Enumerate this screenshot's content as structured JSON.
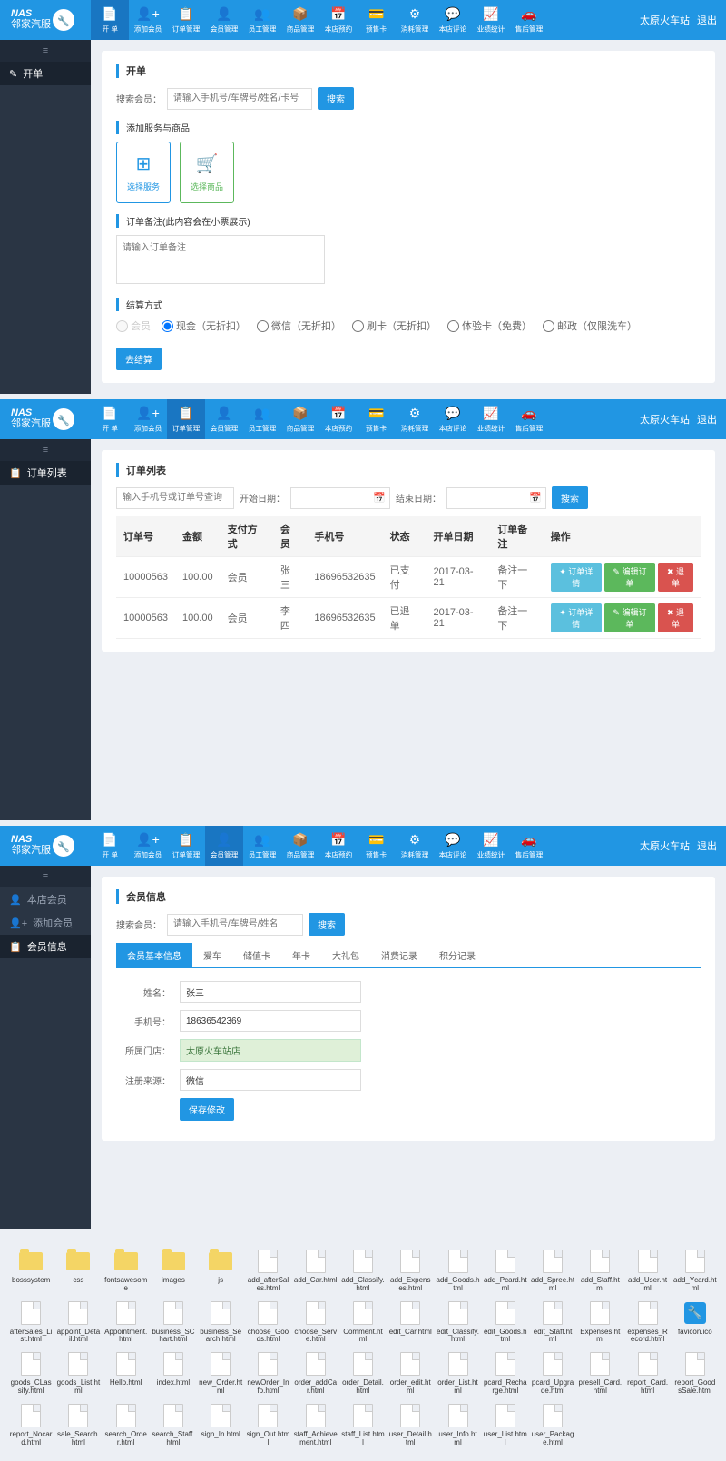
{
  "topbar": {
    "station": "太原火车站",
    "logout": "退出"
  },
  "nav": [
    {
      "label": "开 单",
      "icon": "📄"
    },
    {
      "label": "添加会员",
      "icon": "👤+"
    },
    {
      "label": "订单管理",
      "icon": "📋"
    },
    {
      "label": "会员管理",
      "icon": "👤"
    },
    {
      "label": "员工管理",
      "icon": "👥"
    },
    {
      "label": "商品管理",
      "icon": "📦"
    },
    {
      "label": "本店预约",
      "icon": "📅"
    },
    {
      "label": "预售卡",
      "icon": "💳"
    },
    {
      "label": "消耗管理",
      "icon": "⚙"
    },
    {
      "label": "本店评论",
      "icon": "💬"
    },
    {
      "label": "业绩统计",
      "icon": "📈"
    },
    {
      "label": "售后管理",
      "icon": "🚗"
    }
  ],
  "s1": {
    "side": [
      {
        "label": "开单",
        "icon": "✎"
      }
    ],
    "title": "开单",
    "search_label": "搜索会员：",
    "search_placeholder": "请输入手机号/车牌号/姓名/卡号",
    "search_btn": "搜索",
    "add_title": "添加服务与商品",
    "card_service": "选择服务",
    "card_goods": "选择商品",
    "remark_title": "订单备注(此内容会在小票展示)",
    "remark_placeholder": "请输入订单备注",
    "pay_title": "结算方式",
    "pay_options": [
      "会员",
      "现金（无折扣）",
      "微信（无折扣）",
      "刷卡（无折扣）",
      "体验卡（免费）",
      "邮政（仅限洗车）"
    ],
    "settle_btn": "去结算"
  },
  "s2": {
    "side": [
      {
        "label": "订单列表",
        "icon": "📋"
      }
    ],
    "title": "订单列表",
    "search_placeholder": "输入手机号或订单号查询",
    "start_label": "开始日期：",
    "end_label": "结束日期：",
    "search_btn": "搜索",
    "cols": [
      "订单号",
      "金额",
      "支付方式",
      "会员",
      "手机号",
      "状态",
      "开单日期",
      "订单备注",
      "操作"
    ],
    "rows": [
      {
        "no": "10000563",
        "amt": "100.00",
        "pay": "会员",
        "member": "张三",
        "phone": "18696532635",
        "status": "已支付",
        "date": "2017-03-21",
        "remark": "备注一下"
      },
      {
        "no": "10000563",
        "amt": "100.00",
        "pay": "会员",
        "member": "李四",
        "phone": "18696532635",
        "status": "已退单",
        "date": "2017-03-21",
        "remark": "备注一下"
      }
    ],
    "op_detail": "✦ 订单详情",
    "op_edit": "✎ 编辑订单",
    "op_refund": "✖ 退单"
  },
  "s3": {
    "side": [
      {
        "label": "本店会员",
        "icon": "👤"
      },
      {
        "label": "添加会员",
        "icon": "👤+"
      },
      {
        "label": "会员信息",
        "icon": "📋"
      }
    ],
    "title": "会员信息",
    "search_label": "搜索会员：",
    "search_placeholder": "请输入手机号/车牌号/姓名",
    "search_btn": "搜索",
    "tabs": [
      "会员基本信息",
      "爱车",
      "储值卡",
      "年卡",
      "大礼包",
      "消费记录",
      "积分记录"
    ],
    "form": {
      "name_label": "姓名：",
      "name": "张三",
      "phone_label": "手机号：",
      "phone": "18636542369",
      "store_label": "所属门店：",
      "store": "太原火车站店",
      "source_label": "注册来源：",
      "source": "微信"
    },
    "save_btn": "保存修改"
  },
  "files": [
    {
      "t": "folder",
      "n": "bosssystem"
    },
    {
      "t": "folder",
      "n": "css"
    },
    {
      "t": "folder",
      "n": "fontsawesome"
    },
    {
      "t": "folder",
      "n": "images"
    },
    {
      "t": "folder",
      "n": "js"
    },
    {
      "t": "html",
      "n": "add_afterSales.html"
    },
    {
      "t": "html",
      "n": "add_Car.html"
    },
    {
      "t": "html",
      "n": "add_Classify.html"
    },
    {
      "t": "html",
      "n": "add_Expenses.html"
    },
    {
      "t": "html",
      "n": "add_Goods.html"
    },
    {
      "t": "html",
      "n": "add_Pcard.html"
    },
    {
      "t": "html",
      "n": "add_Spree.html"
    },
    {
      "t": "html",
      "n": "add_Staff.html"
    },
    {
      "t": "html",
      "n": "add_User.html"
    },
    {
      "t": "html",
      "n": "add_Ycard.html"
    },
    {
      "t": "html",
      "n": "afterSales_List.html"
    },
    {
      "t": "html",
      "n": "appoint_Detail.html"
    },
    {
      "t": "html",
      "n": "Appointment.html"
    },
    {
      "t": "html",
      "n": "business_SChart.html"
    },
    {
      "t": "html",
      "n": "business_Search.html"
    },
    {
      "t": "html",
      "n": "choose_Goods.html"
    },
    {
      "t": "html",
      "n": "choose_Serve.html"
    },
    {
      "t": "html",
      "n": "Comment.html"
    },
    {
      "t": "html",
      "n": "edit_Car.html"
    },
    {
      "t": "html",
      "n": "edit_Classify.html"
    },
    {
      "t": "html",
      "n": "edit_Goods.html"
    },
    {
      "t": "html",
      "n": "edit_Staff.html"
    },
    {
      "t": "html",
      "n": "Expenses.html"
    },
    {
      "t": "html",
      "n": "expenses_Record.html"
    },
    {
      "t": "fav",
      "n": "favicon.ico"
    },
    {
      "t": "html",
      "n": "goods_CLassify.html"
    },
    {
      "t": "html",
      "n": "goods_List.html"
    },
    {
      "t": "html",
      "n": "Hello.html"
    },
    {
      "t": "html",
      "n": "index.html"
    },
    {
      "t": "html",
      "n": "new_Order.html"
    },
    {
      "t": "html",
      "n": "newOrder_Info.html"
    },
    {
      "t": "html",
      "n": "order_addCar.html"
    },
    {
      "t": "html",
      "n": "order_Detail.html"
    },
    {
      "t": "html",
      "n": "order_edit.html"
    },
    {
      "t": "html",
      "n": "order_List.html"
    },
    {
      "t": "html",
      "n": "pcard_Recharge.html"
    },
    {
      "t": "html",
      "n": "pcard_Upgrade.html"
    },
    {
      "t": "html",
      "n": "presell_Card.html"
    },
    {
      "t": "html",
      "n": "report_Card.html"
    },
    {
      "t": "html",
      "n": "report_GoodsSale.html"
    },
    {
      "t": "html",
      "n": "report_Nocard.html"
    },
    {
      "t": "html",
      "n": "sale_Search.html"
    },
    {
      "t": "html",
      "n": "search_Order.html"
    },
    {
      "t": "html",
      "n": "search_Staff.html"
    },
    {
      "t": "html",
      "n": "sign_In.html"
    },
    {
      "t": "html",
      "n": "sign_Out.html"
    },
    {
      "t": "html",
      "n": "staff_Achievement.html"
    },
    {
      "t": "html",
      "n": "staff_List.html"
    },
    {
      "t": "html",
      "n": "user_Detail.html"
    },
    {
      "t": "html",
      "n": "user_Info.html"
    },
    {
      "t": "html",
      "n": "user_List.html"
    },
    {
      "t": "html",
      "n": "user_Package.html"
    }
  ]
}
